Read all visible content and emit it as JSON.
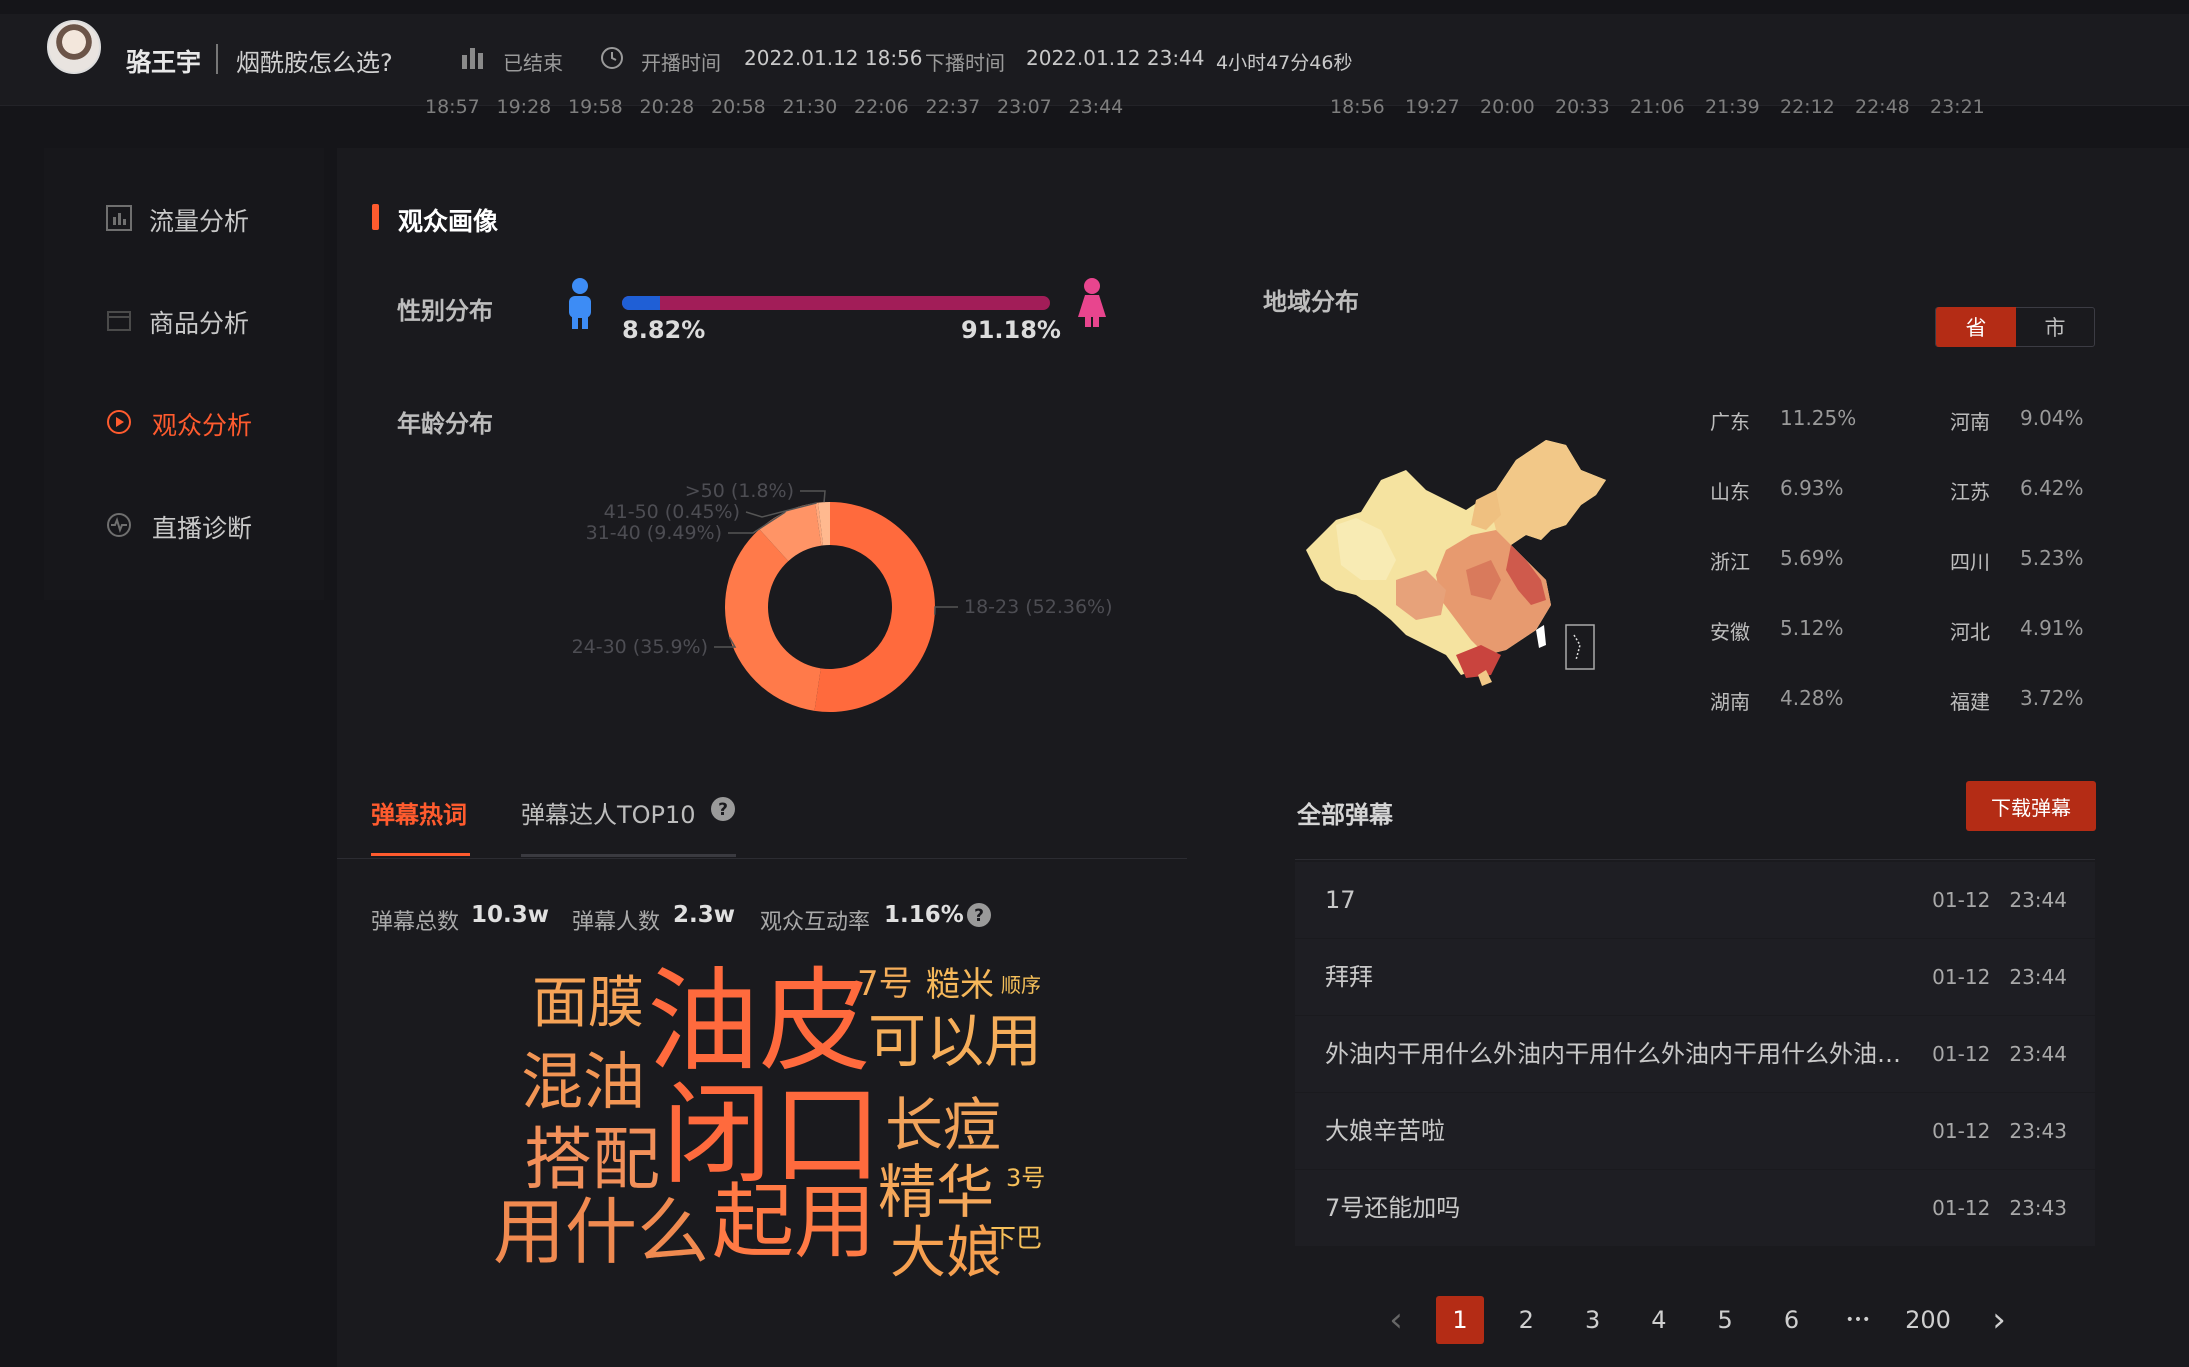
{
  "header": {
    "anchor_name": "骆王宇",
    "live_title": "烟酰胺怎么选?",
    "status": "已结束",
    "start_label": "开播时间",
    "start_value": "2022.01.12 18:56",
    "end_label": "下播时间",
    "end_value": "2022.01.12 23:44",
    "duration": "4小时47分46秒",
    "icons": [
      "bar-chart-icon",
      "clock-icon"
    ]
  },
  "timeline_left": [
    "18:57",
    "19:28",
    "19:58",
    "20:28",
    "20:58",
    "21:30",
    "22:06",
    "22:37",
    "23:07",
    "23:44"
  ],
  "timeline_right": [
    "18:56",
    "19:27",
    "20:00",
    "20:33",
    "21:06",
    "21:39",
    "22:12",
    "22:48",
    "23:21"
  ],
  "sidebar": {
    "items": [
      {
        "label": "流量分析",
        "icon": "bar-chart-icon"
      },
      {
        "label": "商品分析",
        "icon": "product-icon"
      },
      {
        "label": "观众分析",
        "icon": "play-circle-icon"
      },
      {
        "label": "直播诊断",
        "icon": "pulse-icon"
      }
    ],
    "active_index": 2
  },
  "audience": {
    "title": "观众画像",
    "gender_label": "性别分布",
    "male_pct": "8.82%",
    "female_pct": "91.18%",
    "male_fraction": 0.0882,
    "colors": {
      "accent": "#ff5b2e",
      "male": "#1f5fd6",
      "female": "#a21d58",
      "male_icon": "#3d8cf5",
      "female_icon": "#e8458e"
    },
    "age_label": "年龄分布",
    "region_label": "地域分布",
    "toggle": {
      "province": "省",
      "city": "市"
    },
    "regions": [
      {
        "name": "广东",
        "value": "11.25%"
      },
      {
        "name": "河南",
        "value": "9.04%"
      },
      {
        "name": "山东",
        "value": "6.93%"
      },
      {
        "name": "江苏",
        "value": "6.42%"
      },
      {
        "name": "浙江",
        "value": "5.69%"
      },
      {
        "name": "四川",
        "value": "5.23%"
      },
      {
        "name": "安徽",
        "value": "5.12%"
      },
      {
        "name": "河北",
        "value": "4.91%"
      },
      {
        "name": "湖南",
        "value": "4.28%"
      },
      {
        "name": "福建",
        "value": "3.72%"
      }
    ]
  },
  "chart_data": {
    "type": "pie",
    "categories": [
      "18-23",
      "24-30",
      "31-40",
      "41-50",
      ">50"
    ],
    "values": [
      52.36,
      35.9,
      9.49,
      0.45,
      1.8
    ],
    "labels": [
      "18-23 (52.36%)",
      "24-30 (35.9%)",
      "31-40 (9.49%)",
      "41-50 (0.45%)",
      ">50 (1.8%)"
    ],
    "colors": [
      "#ff6a3d",
      "#ff7a4a",
      "#ff9466",
      "#ffa97d",
      "#ffb98f"
    ],
    "donut": true
  },
  "danmu": {
    "tab_hot": "弹幕热词",
    "tab_top10": "弹幕达人TOP10",
    "total_label": "弹幕总数",
    "total_value": "10.3w",
    "people_label": "弹幕人数",
    "people_value": "2.3w",
    "rate_label": "观众互动率",
    "rate_value": "1.16%",
    "words": [
      "面膜",
      "油皮",
      "7号",
      "糙米",
      "顺序",
      "混油",
      "可以用",
      "闭口",
      "长痘",
      "搭配",
      "精华",
      "3号",
      "用什么",
      "起用",
      "大娘",
      "下巴"
    ],
    "all_title": "全部弹幕",
    "download_label": "下载弹幕",
    "rows": [
      {
        "text": "17",
        "time": "01-12   23:44"
      },
      {
        "text": "拜拜",
        "time": "01-12   23:44"
      },
      {
        "text": "外油内干用什么外油内干用什么外油内干用什么外油…",
        "time": "01-12   23:44"
      },
      {
        "text": "大娘辛苦啦",
        "time": "01-12   23:43"
      },
      {
        "text": "7号还能加吗",
        "time": "01-12   23:43"
      }
    ]
  },
  "pagination": {
    "prev": "‹",
    "next": "›",
    "pages": [
      "1",
      "2",
      "3",
      "4",
      "5",
      "6"
    ],
    "ellipsis": "•••",
    "last": "200",
    "current": "1"
  }
}
